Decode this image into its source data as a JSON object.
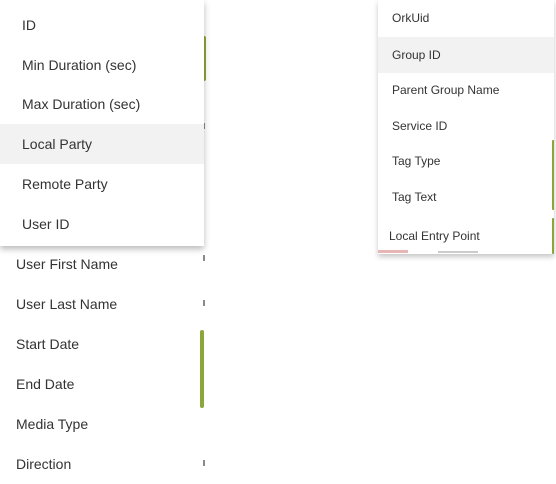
{
  "left_dropdown": {
    "items": [
      {
        "label": "ID",
        "active": false
      },
      {
        "label": "Min Duration (sec)",
        "active": false
      },
      {
        "label": "Max Duration (sec)",
        "active": false
      },
      {
        "label": "Local Party",
        "active": true
      },
      {
        "label": "Remote Party",
        "active": false
      },
      {
        "label": "User ID",
        "active": false
      }
    ]
  },
  "left_list": {
    "items": [
      {
        "label": "User First Name"
      },
      {
        "label": "User Last Name"
      },
      {
        "label": "Start Date"
      },
      {
        "label": "End Date"
      },
      {
        "label": "Media Type"
      },
      {
        "label": "Direction"
      }
    ]
  },
  "right_dropdown": {
    "items": [
      {
        "label": "OrkUid",
        "active": false
      },
      {
        "label": "Group ID",
        "active": true
      },
      {
        "label": "Parent Group Name",
        "active": false
      },
      {
        "label": "Service ID",
        "active": false
      },
      {
        "label": "Tag Type",
        "active": false
      },
      {
        "label": "Tag Text",
        "active": false
      },
      {
        "label": "Local Entry Point",
        "active": false
      }
    ]
  },
  "colors": {
    "accent_green": "#8da63b",
    "hover_bg": "#f2f2f2",
    "text": "#333333"
  }
}
